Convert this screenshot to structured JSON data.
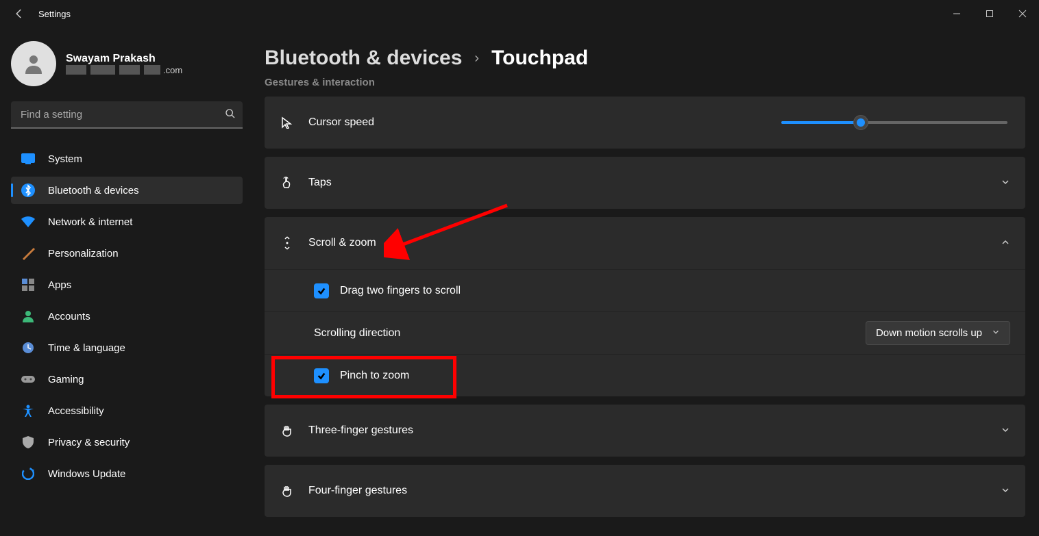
{
  "app_title": "Settings",
  "win_controls": {
    "minimize": "−",
    "maximize": "☐",
    "close": "✕"
  },
  "profile": {
    "name": "Swayam Prakash",
    "email_suffix": ".com"
  },
  "search_placeholder": "Find a setting",
  "sidebar": {
    "items": [
      {
        "label": "System"
      },
      {
        "label": "Bluetooth & devices"
      },
      {
        "label": "Network & internet"
      },
      {
        "label": "Personalization"
      },
      {
        "label": "Apps"
      },
      {
        "label": "Accounts"
      },
      {
        "label": "Time & language"
      },
      {
        "label": "Gaming"
      },
      {
        "label": "Accessibility"
      },
      {
        "label": "Privacy & security"
      },
      {
        "label": "Windows Update"
      }
    ]
  },
  "breadcrumb": {
    "parent": "Bluetooth & devices",
    "current": "Touchpad"
  },
  "section_header": "Gestures & interaction",
  "rows": {
    "cursor_speed": "Cursor speed",
    "taps": "Taps",
    "scroll_zoom": "Scroll & zoom",
    "drag_two": "Drag two fingers to scroll",
    "scroll_dir": "Scrolling direction",
    "scroll_dir_value": "Down motion scrolls up",
    "pinch_zoom": "Pinch to zoom",
    "three_finger": "Three-finger gestures",
    "four_finger": "Four-finger gestures"
  }
}
